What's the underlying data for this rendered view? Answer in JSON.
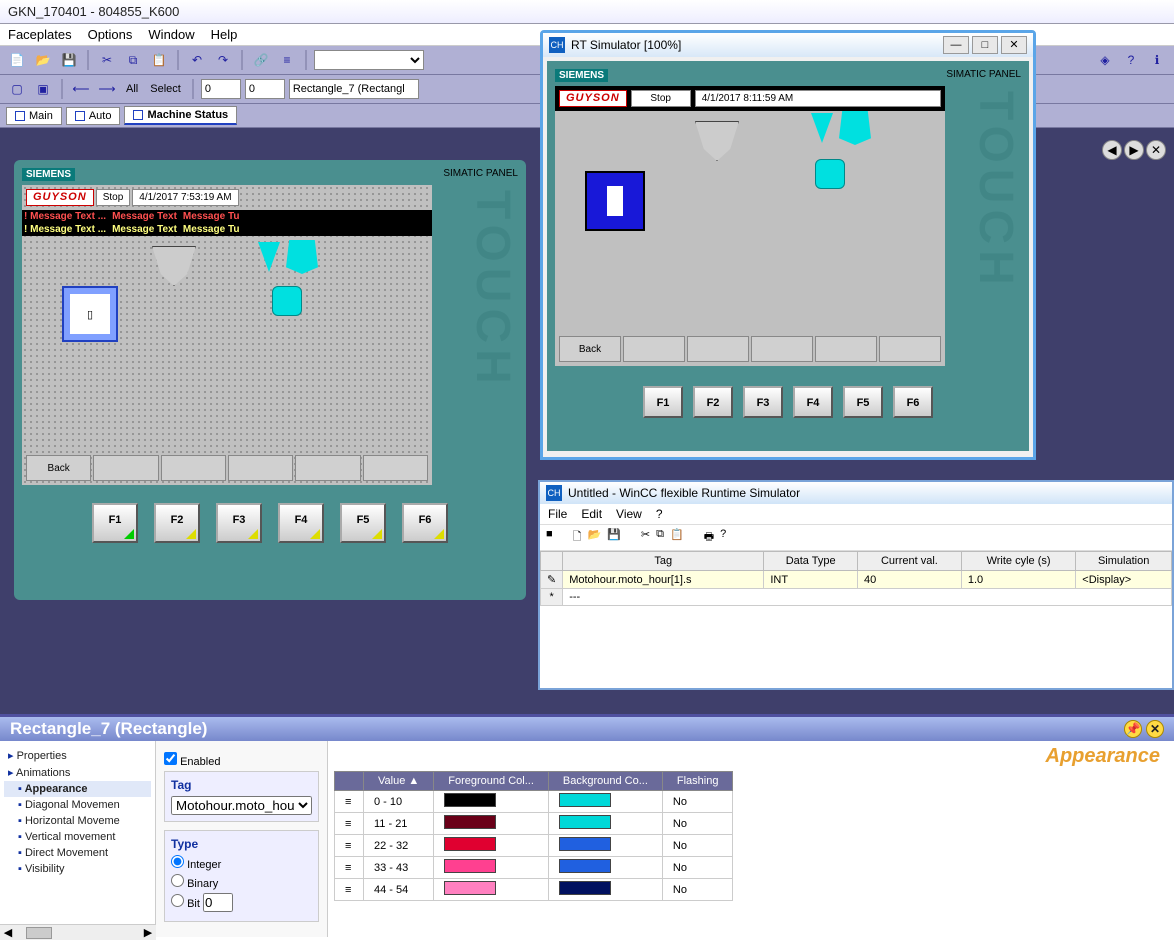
{
  "app_title": "GKN_170401 - 804855_K600",
  "menubar": {
    "faceplates": "Faceplates",
    "options": "Options",
    "window": "Window",
    "help": "Help"
  },
  "toolbar2": {
    "all": "All",
    "select": "Select",
    "num1": "0",
    "num2": "0",
    "combo": "Rectangle_7 (Rectangl"
  },
  "tabs": {
    "main": "Main",
    "auto": "Auto",
    "status": "Machine Status"
  },
  "left_hmi": {
    "siemens": "SIEMENS",
    "panel_label": "SIMATIC PANEL",
    "touch": "TOUCH",
    "brand": "GUYSON",
    "stop": " Stop ",
    "time": "4/1/2017 7:53:19 AM",
    "msg": "! Message Text ...",
    "msg_red": "Message Text",
    "msg_tu": "Message Tu",
    "back": "Back",
    "fkeys": [
      "F1",
      "F2",
      "F3",
      "F4",
      "F5",
      "F6"
    ]
  },
  "rt": {
    "title": "RT Simulator [100%]",
    "siemens": "SIEMENS",
    "panel_label": "SIMATIC PANEL",
    "touch": "TOUCH",
    "brand": "GUYSON",
    "stop": "Stop",
    "time": "4/1/2017 8:11:59 AM",
    "back": "Back",
    "fkeys": [
      "F1",
      "F2",
      "F3",
      "F4",
      "F5",
      "F6"
    ]
  },
  "rts": {
    "title": "Untitled - WinCC flexible Runtime Simulator",
    "menu": {
      "file": "File",
      "edit": "Edit",
      "view": "View",
      "help": "?"
    },
    "cols": {
      "tag": "Tag",
      "dt": "Data Type",
      "cv": "Current val.",
      "wc": "Write cyle (s)",
      "sim": "Simulation"
    },
    "row": {
      "tag": "Motohour.moto_hour[1].s",
      "dt": "INT",
      "cv": "40",
      "wc": "1.0",
      "sim": "<Display>"
    },
    "blank": "---"
  },
  "prop": {
    "title": "Rectangle_7 (Rectangle)",
    "tree": {
      "props": "Properties",
      "anim": "Animations",
      "app": "Appearance",
      "diag": "Diagonal Movemen",
      "horiz": "Horizontal Moveme",
      "vert": "Vertical movement",
      "direct": "Direct Movement",
      "vis": "Visibility"
    },
    "enabled": "Enabled",
    "tag_h": "Tag",
    "tag_v": "Motohour.moto_hour[",
    "type_h": "Type",
    "int": "Integer",
    "bin": "Binary",
    "bit": "Bit",
    "bitn": "0",
    "header": "Appearance",
    "cols": {
      "val": "Value",
      "fg": "Foreground Col...",
      "bg": "Background Co...",
      "fl": "Flashing"
    },
    "rows": [
      {
        "v": "0 - 10",
        "fg": "#000000",
        "bg": "#00d8d8",
        "f": "No"
      },
      {
        "v": "11 - 21",
        "fg": "#6a0018",
        "bg": "#00d8d8",
        "f": "No"
      },
      {
        "v": "22 - 32",
        "fg": "#e00030",
        "bg": "#2060e0",
        "f": "No"
      },
      {
        "v": "33 - 43",
        "fg": "#ff4090",
        "bg": "#2060e0",
        "f": "No"
      },
      {
        "v": "44 - 54",
        "fg": "#ff80c0",
        "bg": "#001060",
        "f": "No"
      }
    ]
  }
}
